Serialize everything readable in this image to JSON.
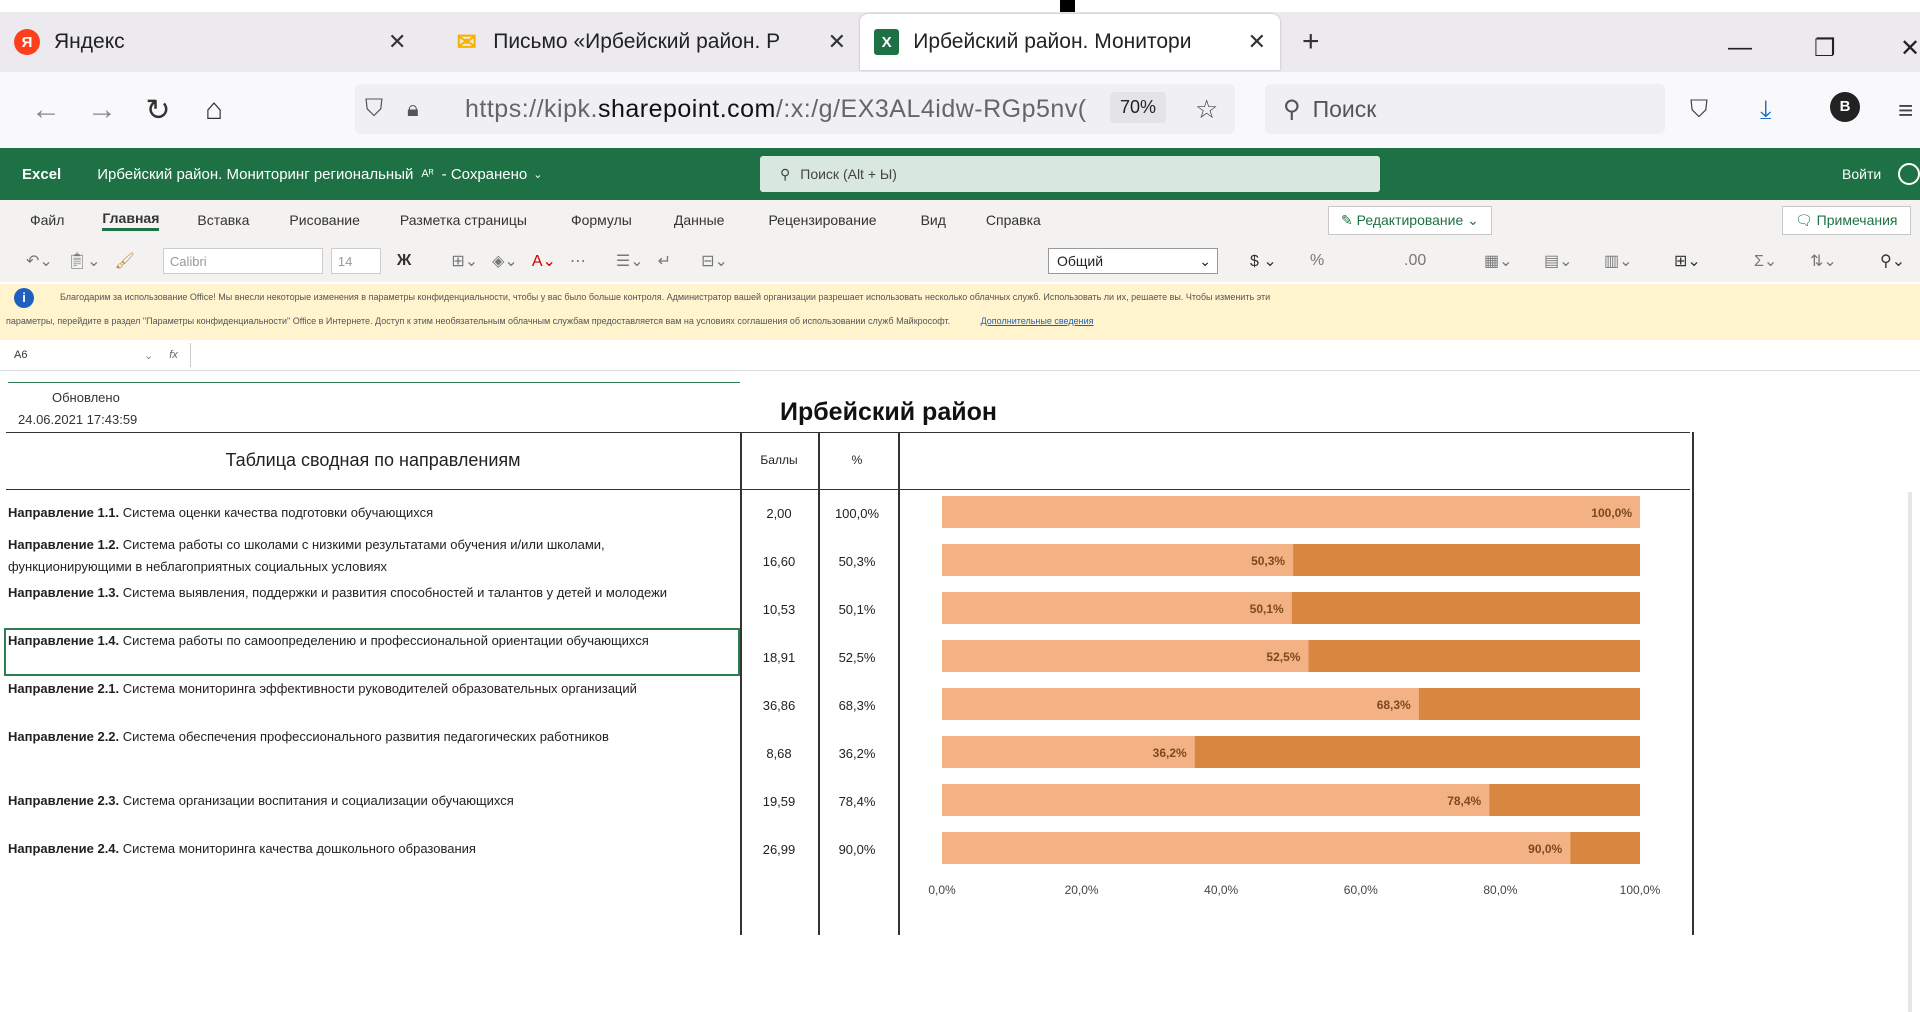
{
  "browser": {
    "tabs": [
      {
        "label": "Яндекс",
        "icon": "yandex-icon"
      },
      {
        "label": "Письмо «Ирбейский район. Р",
        "icon": "mail-icon"
      },
      {
        "label": "Ирбейский район. Монитори",
        "icon": "excel-icon"
      }
    ],
    "url_prefix": "https://kipk.",
    "url_domain": "sharepoint.com",
    "url_suffix": "/:x:/g/EX3AL4idw-RGp5nv(",
    "zoom": "70%",
    "search_placeholder": "Поиск",
    "profile_letter": "B"
  },
  "excel": {
    "app": "Excel",
    "doc_title": "Ирбейский район. Мониторинг региональный",
    "doc_status": "- Сохранено",
    "search_placeholder": "Поиск (Alt + Ы)",
    "signin": "Войти",
    "menu": [
      "Файл",
      "Главная",
      "Вставка",
      "Рисование",
      "Разметка страницы",
      "Формулы",
      "Данные",
      "Рецензирование",
      "Вид",
      "Справка"
    ],
    "edit_mode": "Редактирование",
    "notes_button": "Примечания",
    "font_name": "Calibri",
    "font_size": "14",
    "number_format": "Общий",
    "info_line1": "Благодарим за использование Office! Мы внесли некоторые изменения в параметры конфиденциальности, чтобы у вас было больше контроля. Администратор вашей организации разрешает использовать несколько облачных служб. Использовать ли их, решаете вы. Чтобы изменить эти",
    "info_line2": "параметры, перейдите в раздел \"Параметры конфиденциальности\" Office в Интернете. Доступ к этим необязательным облачным службам предоставляется вам на условиях соглашения об использовании служб Майкрософт.",
    "info_link": "Дополнительные сведения",
    "cell_ref": "A6"
  },
  "sheet": {
    "updated_label": "Обновлено",
    "updated_date": "24.06.2021 17:43:59",
    "region": "Ирбейский район",
    "table_title": "Таблица сводная по направлениям",
    "col_score": "Баллы",
    "col_pct": "%",
    "rows": [
      {
        "head": "Направление 1.1.",
        "text": "Система оценки качества подготовки обучающихся",
        "score": "2,00",
        "pct": "100,0%"
      },
      {
        "head": "Направление 1.2.",
        "text": "Система работы со школами с низкими результатами обучения и/или школами, функционирующими в неблагоприятных социальных условиях",
        "score": "16,60",
        "pct": "50,3%"
      },
      {
        "head": "Направление 1.3.",
        "text": "Система выявления, поддержки и развития способностей и талантов у детей и молодежи",
        "score": "10,53",
        "pct": "50,1%"
      },
      {
        "head": "Направление 1.4.",
        "text": "Система работы по самоопределению и профессиональной ориентации обучающихся",
        "score": "18,91",
        "pct": "52,5%"
      },
      {
        "head": "Направление 2.1.",
        "text": "Система мониторинга эффективности руководителей образовательных организаций",
        "score": "36,86",
        "pct": "68,3%"
      },
      {
        "head": "Направление 2.2.",
        "text": "Система обеспечения профессионального развития педагогических работников",
        "score": "8,68",
        "pct": "36,2%"
      },
      {
        "head": "Направление 2.3.",
        "text": "Система организации воспитания и социализации обучающихся",
        "score": "19,59",
        "pct": "78,4%"
      },
      {
        "head": "Направление 2.4.",
        "text": "Система мониторинга качества дошкольного образования",
        "score": "26,99",
        "pct": "90,0%"
      }
    ]
  },
  "chart_data": {
    "type": "bar",
    "orientation": "horizontal",
    "stacked": true,
    "categories": [
      "Направление 1.1.",
      "Направление 1.2.",
      "Направление 1.3.",
      "Направление 1.4.",
      "Направление 2.1.",
      "Направление 2.2.",
      "Направление 2.3.",
      "Направление 2.4."
    ],
    "series": [
      {
        "values": [
          100.0,
          50.3,
          50.1,
          52.5,
          68.3,
          36.2,
          78.4,
          90.0
        ],
        "color": "#f4b183"
      },
      {
        "values": [
          0.0,
          49.7,
          49.9,
          47.5,
          31.7,
          63.8,
          21.6,
          10.0
        ],
        "color": "#d98740"
      }
    ],
    "data_labels": [
      "100,0%",
      "50,3%",
      "50,1%",
      "52,5%",
      "68,3%",
      "36,2%",
      "78,4%",
      "90,0%"
    ],
    "x_ticks": [
      "0,0%",
      "20,0%",
      "40,0%",
      "60,0%",
      "80,0%",
      "100,0%"
    ],
    "xlim": [
      0,
      100
    ],
    "grid": false
  }
}
